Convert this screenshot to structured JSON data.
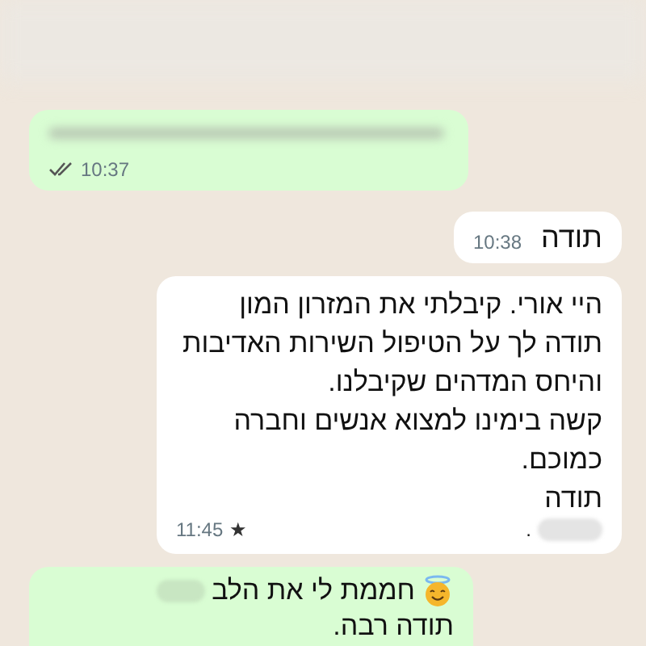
{
  "messages": [
    {
      "kind": "outgoing",
      "time": "10:37",
      "read": true,
      "starred": false,
      "blurred": true,
      "emoji": false
    },
    {
      "kind": "incoming",
      "text": "תודה",
      "time": "10:38",
      "read": false,
      "starred": false,
      "blurred": false,
      "emoji": false
    },
    {
      "kind": "incoming",
      "text": "היי אורי. קיבלתי את המזרון המון תודה לך על הטיפול השירות האדיבות והיחס המדהים שקיבלנו.\nקשה בימינו למצוא אנשים וחברה כמוכם.\nתודה",
      "signature": ".",
      "time": "11:45",
      "star": "★",
      "read": false,
      "starred": true,
      "blurred": false,
      "emoji": false
    },
    {
      "kind": "outgoing",
      "text": "חממת לי את הלב",
      "emoji": true,
      "text2": "תודה רבה.",
      "read": false,
      "starred": false,
      "blurred": false
    }
  ]
}
